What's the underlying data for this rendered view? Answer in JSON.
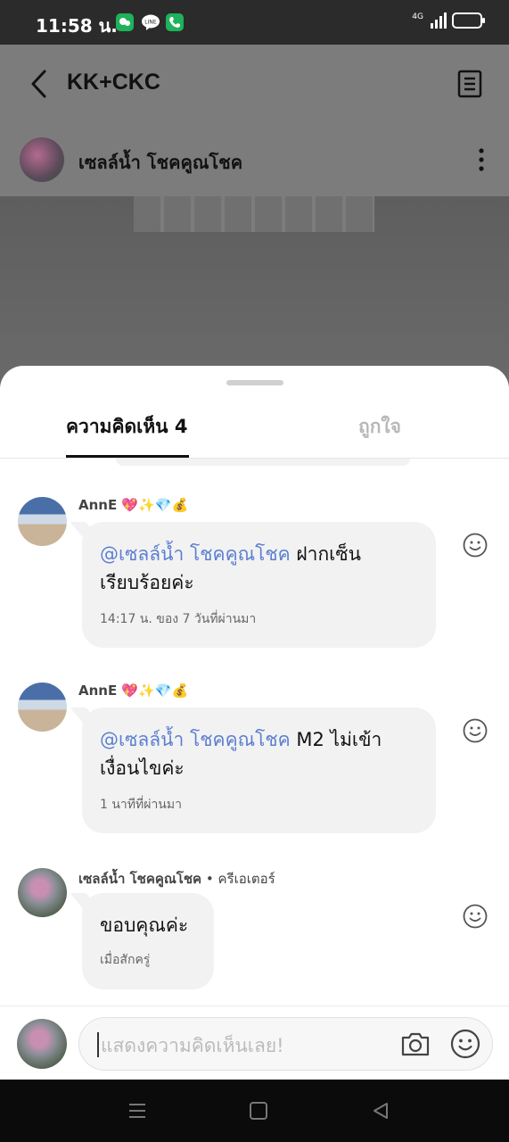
{
  "status_bar": {
    "time": "11:58 น.",
    "network": "4G",
    "icons": [
      "wechat-notification-icon",
      "line-notification-icon",
      "phone-notification-icon",
      "signal-icon",
      "battery-icon"
    ]
  },
  "background": {
    "chat_title": "KK+CKC",
    "post_author": "เซลล์น้ำ โชคคูณโชค"
  },
  "sheet": {
    "tabs": [
      {
        "label": "ความคิดเห็น 4",
        "active": true
      },
      {
        "label": "ถูกใจ",
        "active": false
      }
    ],
    "comments": [
      {
        "name": "AnnE 💖✨💎💰",
        "role": "",
        "mention": "@เซลล์น้ำ โชคคูณโชค",
        "text_after_mention_line1": " ฝากเซ็น",
        "text_line2": "เรียบร้อยค่ะ",
        "time": "14:17 น. ของ 7 วันที่ผ่านมา"
      },
      {
        "name": "AnnE 💖✨💎💰",
        "role": "",
        "mention": "@เซลล์น้ำ โชคคูณโชค",
        "text_after_mention_line1": " M2 ไม่เข้า",
        "text_line2": "เงื่อนไขค่ะ",
        "time": "1 นาทีที่ผ่านมา"
      },
      {
        "name": "เซลล์น้ำ โชคคูณโชค",
        "role": " • ครีเอเตอร์",
        "text": "ขอบคุณค่ะ",
        "time": "เมื่อสักครู่"
      }
    ]
  },
  "composer": {
    "placeholder": "แสดงความคิดเห็นเลย!"
  },
  "colors": {
    "mention": "#5b7fcf",
    "bubble": "#f2f2f3",
    "battery": "#f0c419"
  }
}
